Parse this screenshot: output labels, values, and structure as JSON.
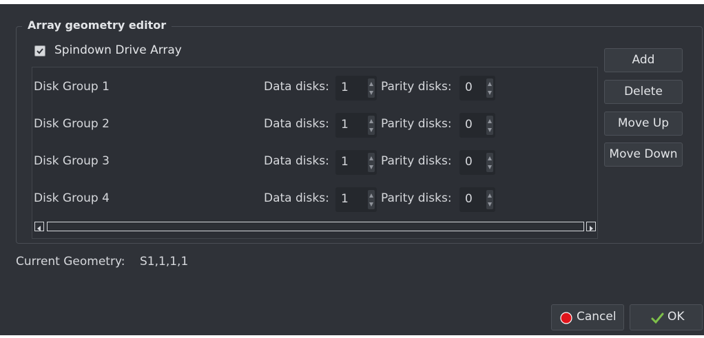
{
  "groupbox": {
    "title": "Array geometry editor"
  },
  "spindown": {
    "label": "Spindown Drive Array",
    "checked": true
  },
  "disk_groups": [
    {
      "name": "Disk Group 1",
      "data_label": "Data disks:",
      "data_value": "1",
      "parity_label": "Parity disks:",
      "parity_value": "0"
    },
    {
      "name": "Disk Group 2",
      "data_label": "Data disks:",
      "data_value": "1",
      "parity_label": "Parity disks:",
      "parity_value": "0"
    },
    {
      "name": "Disk Group 3",
      "data_label": "Data disks:",
      "data_value": "1",
      "parity_label": "Parity disks:",
      "parity_value": "0"
    },
    {
      "name": "Disk Group 4",
      "data_label": "Data disks:",
      "data_value": "1",
      "parity_label": "Parity disks:",
      "parity_value": "0"
    }
  ],
  "side_buttons": {
    "add": "Add",
    "delete": "Delete",
    "move_up": "Move Up",
    "move_down": "Move Down"
  },
  "geometry": {
    "label": "Current Geometry:",
    "value": "S1,1,1,1"
  },
  "dialog_buttons": {
    "cancel": "Cancel",
    "ok": "OK"
  },
  "icons": {
    "cancel": "cancel-red-circle-icon",
    "ok": "ok-check-icon",
    "spin_up": "chevron-up-icon",
    "spin_down": "chevron-down-icon",
    "scroll_left": "scroll-left-arrow-icon",
    "scroll_right": "scroll-right-arrow-icon"
  },
  "colors": {
    "background": "#2f3238",
    "cancel_icon": "#e0141b",
    "ok_icon": "#7ec04a"
  }
}
